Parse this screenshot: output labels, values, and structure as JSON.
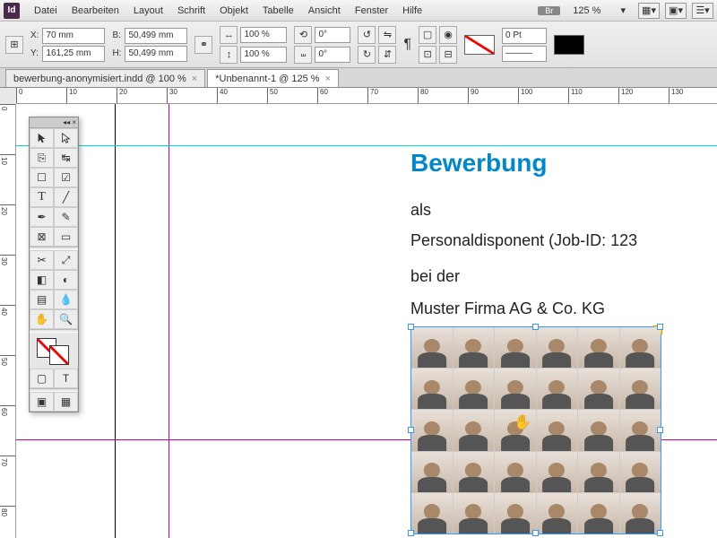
{
  "menu": {
    "items": [
      "Datei",
      "Bearbeiten",
      "Layout",
      "Schrift",
      "Objekt",
      "Tabelle",
      "Ansicht",
      "Fenster",
      "Hilfe"
    ],
    "br": "Br",
    "zoom": "125 %"
  },
  "ctrl": {
    "x_label": "X:",
    "x": "70 mm",
    "y_label": "Y:",
    "y": "161,25 mm",
    "w_label": "B:",
    "w": "50,499 mm",
    "h_label": "H:",
    "h": "50,499 mm",
    "sx": "100 %",
    "sy": "100 %",
    "rot": "0°",
    "shear": "0°",
    "stroke_pt": "0 Pt"
  },
  "tabs": [
    {
      "label": "bewerbung-anonymisiert.indd @ 100 %",
      "active": false
    },
    {
      "label": "*Unbenannt-1 @ 125 %",
      "active": true
    }
  ],
  "ruler_h": [
    0,
    10,
    20,
    30,
    40,
    50,
    60,
    70,
    80,
    90,
    100,
    110,
    120,
    130
  ],
  "ruler_v": [
    0,
    10,
    20,
    30,
    40,
    50,
    60,
    70,
    80
  ],
  "doc": {
    "title": "Bewerbung",
    "line1": "als",
    "line2": "Personaldisponent (Job-ID: 123",
    "line3": "bei der",
    "line4": "Muster Firma AG & Co. KG"
  },
  "tools": [
    "selection",
    "direct-selection",
    "page",
    "gap",
    "content-collector",
    "content-placer",
    "type",
    "line",
    "pen",
    "pencil",
    "rectangle-frame",
    "rectangle",
    "ellipse",
    "polygon",
    "scissors",
    "free-transform",
    "gradient-swatch",
    "gradient-feather",
    "note",
    "eyedropper",
    "hand",
    "zoom"
  ]
}
